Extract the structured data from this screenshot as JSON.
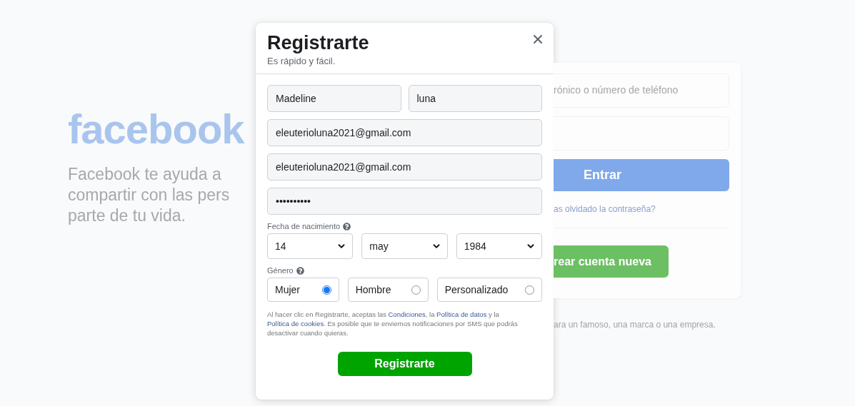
{
  "background": {
    "logo": "facebook",
    "tagline_lines": [
      "Facebook te ayuda a",
      "compartir con las pers",
      "parte de tu vida."
    ],
    "login_card": {
      "email_placeholder": "rónico o número de teléfono",
      "login_button": "Entrar",
      "forgot_link": "as olvidado la contraseña?",
      "create_button": "rear cuenta nueva"
    },
    "footer_text": "ara un famoso, una marca o una empresa."
  },
  "dialog": {
    "title": "Registrarte",
    "subtitle": "Es rápido y fácil.",
    "name_fields": [
      {
        "value": "Madeline"
      },
      {
        "value": "luna"
      }
    ],
    "fields": [
      {
        "value": "eleuterioluna2021@gmail.com"
      },
      {
        "value": "eleuterioluna2021@gmail.com"
      },
      {
        "value": "••••••••••"
      }
    ],
    "birthdate": {
      "label": "Fecha de nacimiento",
      "selects": [
        {
          "value": "14"
        },
        {
          "value": "may"
        },
        {
          "value": "1984"
        }
      ]
    },
    "gender": {
      "label": "Género",
      "options": [
        {
          "label": "Mujer",
          "selected": true
        },
        {
          "label": "Hombre",
          "selected": false
        },
        {
          "label": "Personalizado",
          "selected": false
        }
      ]
    },
    "terms": [
      {
        "kind": "plain",
        "text": "Al hacer clic en Registrarte, aceptas las "
      },
      {
        "kind": "link",
        "text": "Condiciones"
      },
      {
        "kind": "plain",
        "text": ", la "
      },
      {
        "kind": "link",
        "text": "Política de datos"
      },
      {
        "kind": "plain",
        "text": " y la "
      },
      {
        "kind": "link",
        "text": "Política de cookies"
      },
      {
        "kind": "plain",
        "text": ". Es posible que te enviemos notificaciones por SMS que podrás desactivar cuando quieras."
      }
    ],
    "submit_button": "Registrarte"
  }
}
